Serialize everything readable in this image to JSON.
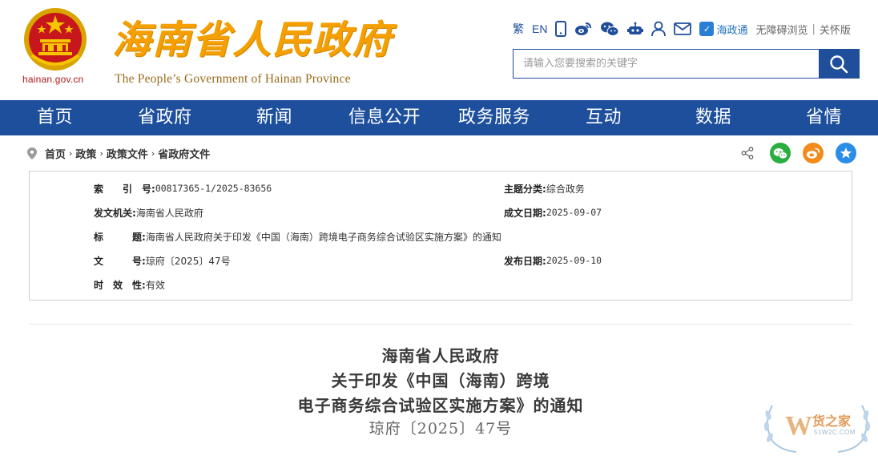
{
  "header": {
    "domain": "hainan.gov.cn",
    "title": "海南省人民政府",
    "subtitle": "The People’s Government  of Hainan Province",
    "toolbar": {
      "traditional": "繁",
      "english": "EN",
      "zhengtong": "海政通",
      "accessibility": "无障碍浏览",
      "separator": "|",
      "care": "关怀版"
    },
    "search": {
      "placeholder": "请输入您要搜索的关键字"
    }
  },
  "nav": {
    "items": [
      "首页",
      "省政府",
      "新闻",
      "信息公开",
      "政务服务",
      "互动",
      "数据",
      "省情"
    ]
  },
  "breadcrumb": {
    "items": [
      "首页",
      "政策",
      "政策文件",
      "省政府文件"
    ],
    "arrow": "›"
  },
  "info": {
    "index_label": "索　　引　号:",
    "index_value": "00817365-1/2025-83656",
    "topic_label": "主题分类:",
    "topic_value": "综合政务",
    "issuer_label": "发文机关:",
    "issuer_value": "海南省人民政府",
    "date_written_label": "成文日期:",
    "date_written_value": "2025-09-07",
    "subject_label": "标　　　题:",
    "subject_value": "海南省人民政府关于印发《中国（海南）跨境电子商务综合试验区实施方案》的通知",
    "docno_label": "文　　　号:",
    "docno_value": "琼府〔2025〕47号",
    "date_published_label": "发布日期:",
    "date_published_value": "2025-09-10",
    "validity_label": "时　效　性:",
    "validity_value": "有效"
  },
  "document": {
    "title_line1": "海南省人民政府",
    "title_line2": "关于印发《中国（海南）跨境",
    "title_line3": "电子商务综合试验区实施方案》的通知",
    "doc_number": "琼府〔2025〕47号"
  },
  "watermark": {
    "text": "货之家",
    "url": "51W2C.COM"
  },
  "colors": {
    "nav_bg": "#1d4f9c",
    "title_gold": "#f5a000",
    "emblem_red": "#c8161d",
    "wechat_green": "#2aae3f",
    "weibo_orange": "#f18b1c",
    "favorite_blue": "#2a8ee6"
  }
}
